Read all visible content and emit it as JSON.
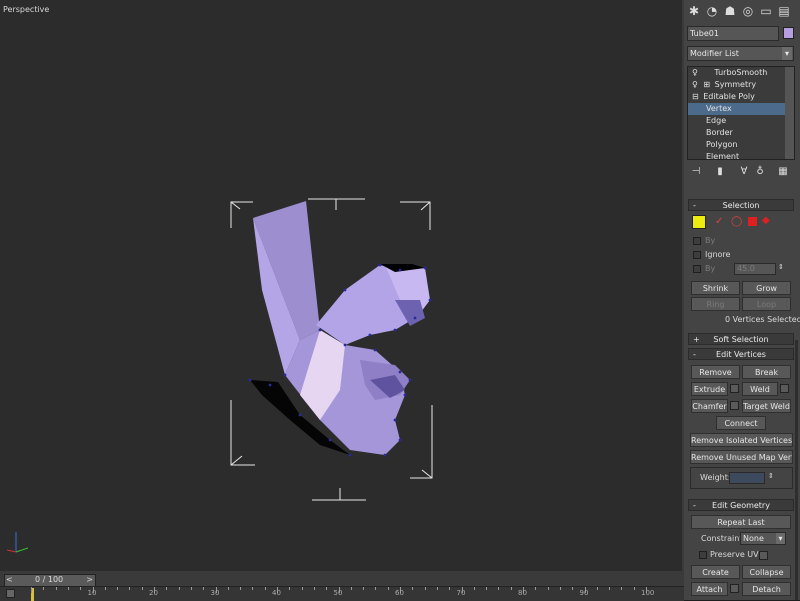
{
  "viewport": {
    "label": "Perspective"
  },
  "panel": {
    "tabs": [
      "create-icon",
      "modify-icon",
      "hierarchy-icon",
      "motion-icon",
      "display-icon",
      "utilities-icon"
    ],
    "object_name": "Tube01",
    "object_color": "#b69ee0",
    "modifier_list_label": "Modifier List",
    "stack": [
      {
        "label": "TurboSmooth",
        "level": 0,
        "selected": false
      },
      {
        "label": "Symmetry",
        "level": 0,
        "selected": false
      },
      {
        "label": "Editable Poly",
        "level": 0,
        "selected": false
      },
      {
        "label": "Vertex",
        "level": 1,
        "selected": true
      },
      {
        "label": "Edge",
        "level": 1,
        "selected": false
      },
      {
        "label": "Border",
        "level": 1,
        "selected": false
      },
      {
        "label": "Polygon",
        "level": 1,
        "selected": false
      },
      {
        "label": "Element",
        "level": 1,
        "selected": false
      }
    ],
    "selection": {
      "title": "Selection",
      "by_label": "By",
      "ignore_label": "Ignore",
      "by_angle_label": "By",
      "angle_value": "45.0",
      "shrink_label": "Shrink",
      "grow_label": "Grow",
      "ring_label": "Ring",
      "loop_label": "Loop",
      "status": "0 Vertices Selected"
    },
    "soft_selection": {
      "title": "Soft Selection"
    },
    "edit_vertices": {
      "title": "Edit Vertices",
      "remove": "Remove",
      "break": "Break",
      "extrude": "Extrude",
      "weld": "Weld",
      "chamfer": "Chamfer",
      "target_weld": "Target Weld",
      "connect": "Connect",
      "remove_isolated": "Remove Isolated Vertices",
      "remove_unused": "Remove Unused Map Verts",
      "weight_label": "Weight:"
    },
    "edit_geometry": {
      "title": "Edit Geometry",
      "repeat_last": "Repeat Last",
      "constraints_label": "Constraints:",
      "constraints_value": "None",
      "preserve_uvs": "Preserve UVs",
      "create": "Create",
      "collapse": "Collapse",
      "attach": "Attach",
      "detach": "Detach"
    }
  },
  "timeline": {
    "frame_display": "0 / 100",
    "prev_label": "<",
    "next_label": ">",
    "ruler_labels": [
      "10",
      "20",
      "30",
      "40",
      "50",
      "60",
      "70",
      "80",
      "90",
      "100"
    ]
  },
  "colors": {
    "mesh": "#b7a6e8",
    "selected_stack": "#4b6a8c",
    "vertex": "#2a2aa0"
  }
}
